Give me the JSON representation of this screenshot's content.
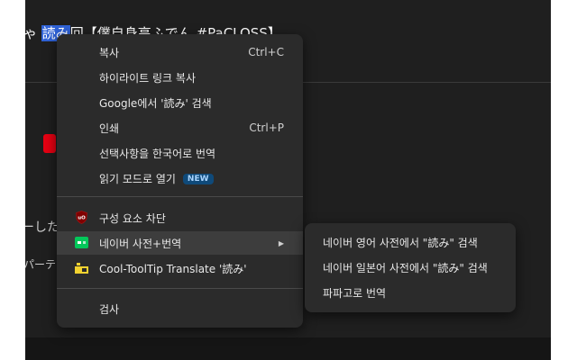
{
  "page": {
    "title_before": "ゃ ",
    "title_selected": "読み",
    "title_after": "回【僕自身高ふでん #PaCLOSS】",
    "snippet_1": "ーした",
    "snippet_2": "パーテ"
  },
  "context_menu": {
    "items": [
      {
        "label": "복사",
        "shortcut": "Ctrl+C"
      },
      {
        "label": "하이라이트 링크 복사"
      },
      {
        "label": "Google에서 '読み' 검색"
      },
      {
        "label": "인쇄",
        "shortcut": "Ctrl+P"
      },
      {
        "label": "선택사항을 한국어로 번역"
      },
      {
        "label": "읽기 모드로 열기",
        "badge": "NEW"
      },
      {
        "label": "구성 요소 차단",
        "icon": "ublock-origin-icon"
      },
      {
        "label": "네이버 사전+번역",
        "icon": "naver-dictionary-icon",
        "submenu": true
      },
      {
        "label": "Cool-ToolTip Translate '読み'",
        "icon": "cool-tooltip-icon"
      },
      {
        "label": "검사"
      }
    ]
  },
  "submenu": {
    "items": [
      {
        "label": "네이버 영어 사전에서 \"読み\" 검색"
      },
      {
        "label": "네이버 일본어 사전에서 \"読み\" 검색"
      },
      {
        "label": "파파고로 번역"
      }
    ]
  },
  "colors": {
    "menu_bg": "#2b2b2b",
    "page_bg": "#1f1f1f",
    "selection": "#2f62d6",
    "new_badge_bg": "#0f4a7a",
    "naver_green": "#03c75a"
  }
}
